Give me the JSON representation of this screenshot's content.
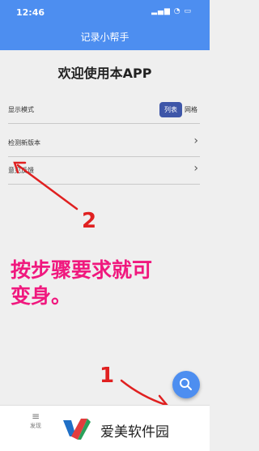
{
  "status_bar": {
    "time": "12:46"
  },
  "header": {
    "title": "记录小帮手"
  },
  "welcome": "欢迎使用本APP",
  "settings": {
    "display_mode": {
      "label": "显示模式",
      "options": [
        "列表",
        "网格"
      ],
      "selected": "列表"
    },
    "check_update": {
      "label": "检测新版本"
    },
    "feedback": {
      "label": "意见反馈"
    }
  },
  "annotation": {
    "text_line1": "按步骤要求就可",
    "text_line2": "变身。",
    "step1": "1",
    "step2": "2"
  },
  "bottom_nav": {
    "discover_label": "发现"
  },
  "watermark": {
    "text": "爱美软件园"
  },
  "colors": {
    "primary": "#4d8ef0",
    "segment_active": "#3e56a8",
    "annotation_pink": "#f0187e",
    "annotation_red": "#e02020"
  }
}
